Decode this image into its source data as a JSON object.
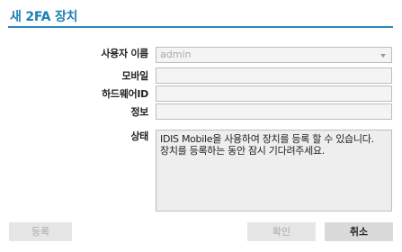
{
  "dialog": {
    "title": "새 2FA 장치"
  },
  "form": {
    "username_label": "사용자 이름",
    "username_value": "admin",
    "mobile_label": "모바일",
    "mobile_value": "",
    "hardware_id_label": "하드웨어ID",
    "hardware_id_value": "",
    "info_label": "정보",
    "info_value": "",
    "status_label": "상태",
    "status_lines": [
      "IDIS Mobile을 사용하여 장치를 등록 할 수 있습니다.",
      "장치를 등록하는 동안 잠시 기다려주세요."
    ]
  },
  "buttons": {
    "register": "등록",
    "confirm": "확인",
    "cancel": "취소"
  },
  "colors": {
    "accent": "#1e7fb6",
    "field_bg": "#f4f4f4",
    "field_border": "#bdbdbd",
    "status_bg": "#eeeeee",
    "disabled_button_bg": "#e6e6e6",
    "cancel_button_bg": "#dadada"
  }
}
